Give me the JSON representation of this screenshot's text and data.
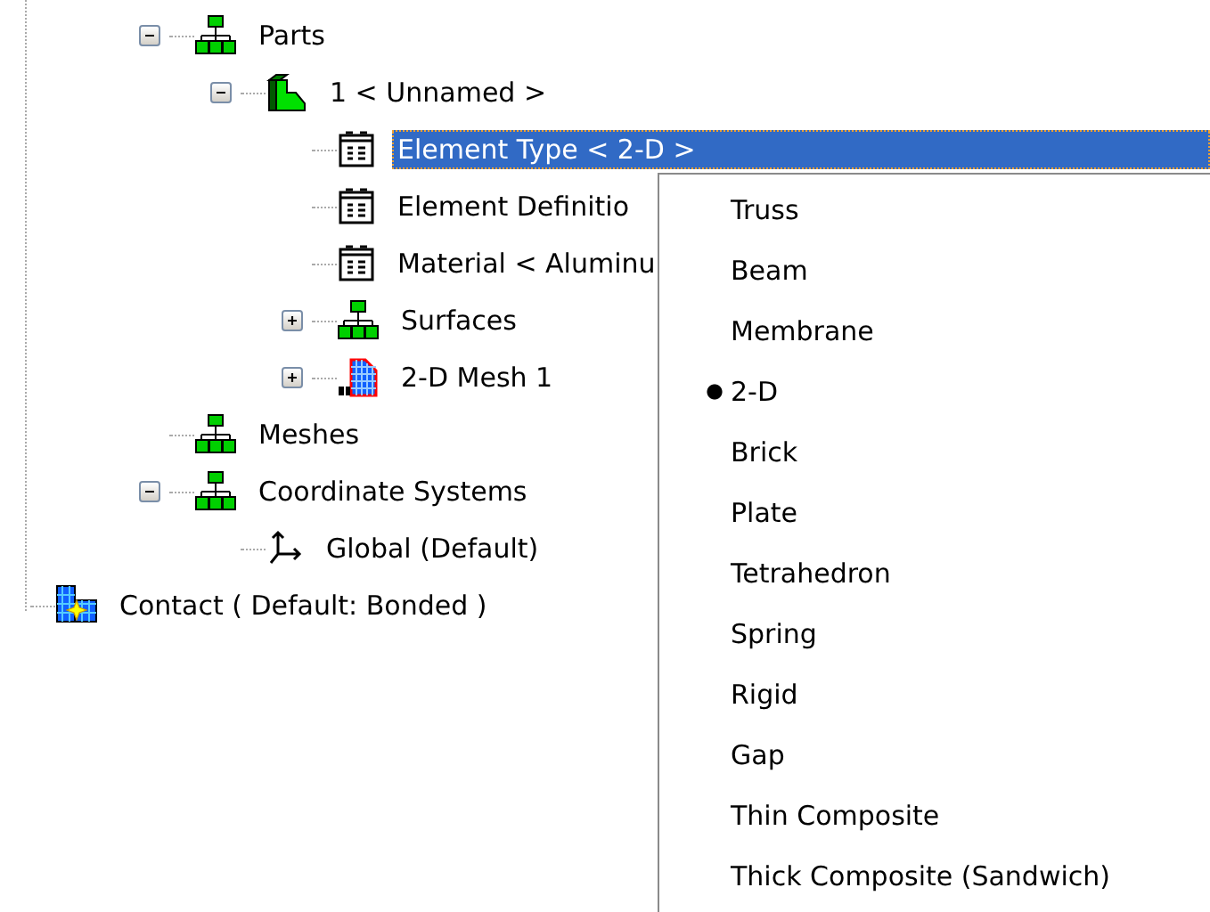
{
  "tree": [
    {
      "children": [
        {
          "label": "Parts",
          "kind": "group",
          "expanded": true,
          "selected": false,
          "children": [
            {
              "label": "1 < Unnamed >",
              "kind": "part",
              "expanded": true,
              "selected": false,
              "children": [
                {
                  "label": "Element Type < 2-D >",
                  "kind": "sheet",
                  "selected": true
                },
                {
                  "label": "Element Definitio",
                  "kind": "sheet",
                  "selected": false
                },
                {
                  "label": "Material < Aluminu",
                  "kind": "sheet",
                  "selected": false
                },
                {
                  "label": "Surfaces",
                  "kind": "group",
                  "expanded": false,
                  "selected": false
                },
                {
                  "label": "2-D Mesh 1",
                  "kind": "mesh",
                  "expanded": false,
                  "selected": false
                }
              ]
            }
          ]
        },
        {
          "label": "Meshes",
          "kind": "group",
          "selected": false
        },
        {
          "label": "Coordinate Systems",
          "kind": "group",
          "expanded": true,
          "selected": false,
          "children": [
            {
              "label": "Global (Default)",
              "kind": "axes",
              "selected": false
            }
          ]
        }
      ]
    },
    {
      "label": "Contact ( Default: Bonded )",
      "kind": "contact",
      "selected": false
    }
  ],
  "menu": [
    {
      "label": "Truss",
      "selected": false
    },
    {
      "label": "Beam",
      "selected": false
    },
    {
      "label": "Membrane",
      "selected": false
    },
    {
      "label": "2-D",
      "selected": true
    },
    {
      "label": "Brick",
      "selected": false
    },
    {
      "label": "Plate",
      "selected": false
    },
    {
      "label": "Tetrahedron",
      "selected": false
    },
    {
      "label": "Spring",
      "selected": false
    },
    {
      "label": "Rigid",
      "selected": false
    },
    {
      "label": "Gap",
      "selected": false
    },
    {
      "label": "Thin Composite",
      "selected": false
    },
    {
      "label": "Thick Composite (Sandwich)",
      "selected": false
    }
  ]
}
